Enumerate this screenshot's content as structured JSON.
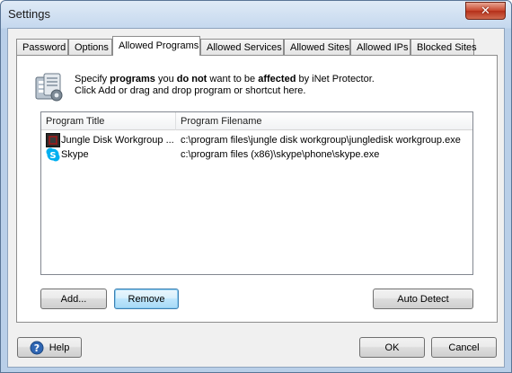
{
  "window": {
    "title": "Settings",
    "close_glyph": "✕"
  },
  "tabs": [
    {
      "label": "Password",
      "active": false
    },
    {
      "label": "Options",
      "active": false
    },
    {
      "label": "Allowed Programs",
      "active": true
    },
    {
      "label": "Allowed Services",
      "active": false
    },
    {
      "label": "Allowed Sites",
      "active": false
    },
    {
      "label": "Allowed IPs",
      "active": false
    },
    {
      "label": "Blocked Sites",
      "active": false
    }
  ],
  "info": {
    "icon": "programs-settings-icon",
    "line1": {
      "part1": "Specify ",
      "bold1": "programs",
      "part2": " you ",
      "bold2": "do not",
      "part3": " want to be ",
      "bold3": "affected",
      "part4": " by iNet Protector."
    },
    "line2": "Click Add or drag and drop program or shortcut here."
  },
  "programs": {
    "columns": [
      "Program Title",
      "Program Filename"
    ],
    "rows": [
      {
        "icon": "jungle-disk-icon",
        "title": "Jungle Disk Workgroup ...",
        "filename": "c:\\program files\\jungle disk workgroup\\jungledisk workgroup.exe"
      },
      {
        "icon": "skype-icon",
        "title": "Skype",
        "filename": "c:\\program files (x86)\\skype\\phone\\skype.exe"
      }
    ]
  },
  "buttons": {
    "add": "Add...",
    "remove": "Remove",
    "auto_detect": "Auto Detect",
    "help": "Help",
    "ok": "OK",
    "cancel": "Cancel"
  },
  "colors": {
    "focus_border": "#3c7fb1",
    "close_button": "#c7452c",
    "skype_blue": "#00aff0"
  }
}
